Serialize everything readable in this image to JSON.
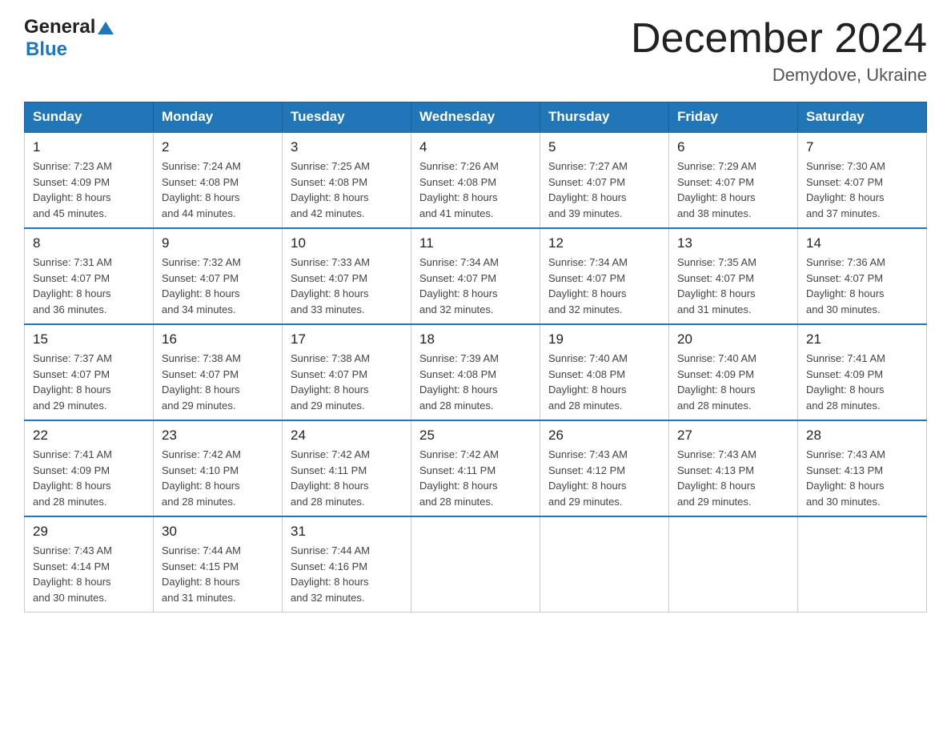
{
  "header": {
    "logo_general": "General",
    "logo_blue": "Blue",
    "title": "December 2024",
    "subtitle": "Demydove, Ukraine"
  },
  "weekdays": [
    "Sunday",
    "Monday",
    "Tuesday",
    "Wednesday",
    "Thursday",
    "Friday",
    "Saturday"
  ],
  "weeks": [
    [
      {
        "day": "1",
        "sunrise": "7:23 AM",
        "sunset": "4:09 PM",
        "daylight": "8 hours and 45 minutes."
      },
      {
        "day": "2",
        "sunrise": "7:24 AM",
        "sunset": "4:08 PM",
        "daylight": "8 hours and 44 minutes."
      },
      {
        "day": "3",
        "sunrise": "7:25 AM",
        "sunset": "4:08 PM",
        "daylight": "8 hours and 42 minutes."
      },
      {
        "day": "4",
        "sunrise": "7:26 AM",
        "sunset": "4:08 PM",
        "daylight": "8 hours and 41 minutes."
      },
      {
        "day": "5",
        "sunrise": "7:27 AM",
        "sunset": "4:07 PM",
        "daylight": "8 hours and 39 minutes."
      },
      {
        "day": "6",
        "sunrise": "7:29 AM",
        "sunset": "4:07 PM",
        "daylight": "8 hours and 38 minutes."
      },
      {
        "day": "7",
        "sunrise": "7:30 AM",
        "sunset": "4:07 PM",
        "daylight": "8 hours and 37 minutes."
      }
    ],
    [
      {
        "day": "8",
        "sunrise": "7:31 AM",
        "sunset": "4:07 PM",
        "daylight": "8 hours and 36 minutes."
      },
      {
        "day": "9",
        "sunrise": "7:32 AM",
        "sunset": "4:07 PM",
        "daylight": "8 hours and 34 minutes."
      },
      {
        "day": "10",
        "sunrise": "7:33 AM",
        "sunset": "4:07 PM",
        "daylight": "8 hours and 33 minutes."
      },
      {
        "day": "11",
        "sunrise": "7:34 AM",
        "sunset": "4:07 PM",
        "daylight": "8 hours and 32 minutes."
      },
      {
        "day": "12",
        "sunrise": "7:34 AM",
        "sunset": "4:07 PM",
        "daylight": "8 hours and 32 minutes."
      },
      {
        "day": "13",
        "sunrise": "7:35 AM",
        "sunset": "4:07 PM",
        "daylight": "8 hours and 31 minutes."
      },
      {
        "day": "14",
        "sunrise": "7:36 AM",
        "sunset": "4:07 PM",
        "daylight": "8 hours and 30 minutes."
      }
    ],
    [
      {
        "day": "15",
        "sunrise": "7:37 AM",
        "sunset": "4:07 PM",
        "daylight": "8 hours and 29 minutes."
      },
      {
        "day": "16",
        "sunrise": "7:38 AM",
        "sunset": "4:07 PM",
        "daylight": "8 hours and 29 minutes."
      },
      {
        "day": "17",
        "sunrise": "7:38 AM",
        "sunset": "4:07 PM",
        "daylight": "8 hours and 29 minutes."
      },
      {
        "day": "18",
        "sunrise": "7:39 AM",
        "sunset": "4:08 PM",
        "daylight": "8 hours and 28 minutes."
      },
      {
        "day": "19",
        "sunrise": "7:40 AM",
        "sunset": "4:08 PM",
        "daylight": "8 hours and 28 minutes."
      },
      {
        "day": "20",
        "sunrise": "7:40 AM",
        "sunset": "4:09 PM",
        "daylight": "8 hours and 28 minutes."
      },
      {
        "day": "21",
        "sunrise": "7:41 AM",
        "sunset": "4:09 PM",
        "daylight": "8 hours and 28 minutes."
      }
    ],
    [
      {
        "day": "22",
        "sunrise": "7:41 AM",
        "sunset": "4:09 PM",
        "daylight": "8 hours and 28 minutes."
      },
      {
        "day": "23",
        "sunrise": "7:42 AM",
        "sunset": "4:10 PM",
        "daylight": "8 hours and 28 minutes."
      },
      {
        "day": "24",
        "sunrise": "7:42 AM",
        "sunset": "4:11 PM",
        "daylight": "8 hours and 28 minutes."
      },
      {
        "day": "25",
        "sunrise": "7:42 AM",
        "sunset": "4:11 PM",
        "daylight": "8 hours and 28 minutes."
      },
      {
        "day": "26",
        "sunrise": "7:43 AM",
        "sunset": "4:12 PM",
        "daylight": "8 hours and 29 minutes."
      },
      {
        "day": "27",
        "sunrise": "7:43 AM",
        "sunset": "4:13 PM",
        "daylight": "8 hours and 29 minutes."
      },
      {
        "day": "28",
        "sunrise": "7:43 AM",
        "sunset": "4:13 PM",
        "daylight": "8 hours and 30 minutes."
      }
    ],
    [
      {
        "day": "29",
        "sunrise": "7:43 AM",
        "sunset": "4:14 PM",
        "daylight": "8 hours and 30 minutes."
      },
      {
        "day": "30",
        "sunrise": "7:44 AM",
        "sunset": "4:15 PM",
        "daylight": "8 hours and 31 minutes."
      },
      {
        "day": "31",
        "sunrise": "7:44 AM",
        "sunset": "4:16 PM",
        "daylight": "8 hours and 32 minutes."
      },
      null,
      null,
      null,
      null
    ]
  ],
  "labels": {
    "sunrise": "Sunrise:",
    "sunset": "Sunset:",
    "daylight": "Daylight:"
  }
}
